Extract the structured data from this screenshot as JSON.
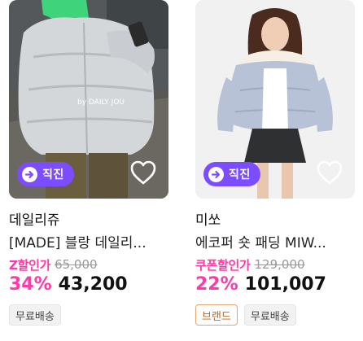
{
  "products": [
    {
      "direct_label": "직진",
      "brand": "데일리쥬",
      "title": "[MADE] 블랑 데일리...",
      "photo_caption": "by DAILY JOU",
      "discount_type": "Z할인가",
      "original_price": "65,000",
      "discount_rate": "34%",
      "price": "43,200",
      "tags": [
        "무료배송"
      ]
    },
    {
      "direct_label": "직진",
      "brand": "미쏘",
      "title": "에코퍼 숏 패딩 MIW...",
      "discount_type": "쿠폰할인가",
      "original_price": "129,000",
      "discount_rate": "22%",
      "price": "101,007",
      "tags": [
        "브랜드",
        "무료배송"
      ]
    }
  ],
  "colors": {
    "accent_purple": "#7b4dff",
    "discount_pink": "#ff3aa8",
    "brand_tag_border": "#e0a56a"
  },
  "icons": {
    "direct_badge": "arrow-right-circle-icon",
    "wishlist": "heart-outline-icon"
  }
}
